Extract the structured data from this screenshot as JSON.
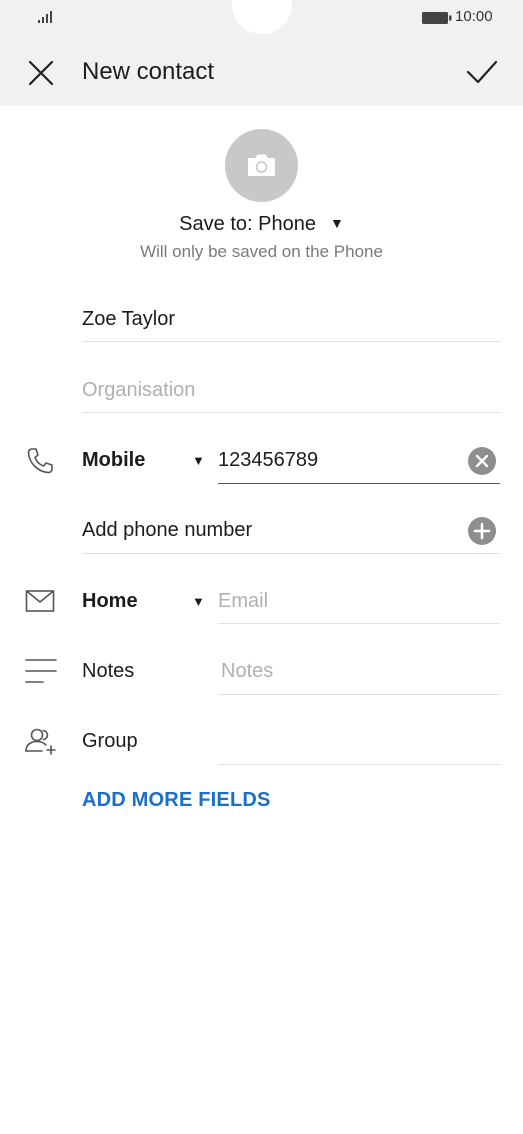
{
  "status": {
    "time": "10:00"
  },
  "header": {
    "title": "New contact"
  },
  "save_to": {
    "label": "Save to: Phone",
    "hint": "Will only be saved on the Phone"
  },
  "fields": {
    "name_value": "Zoe Taylor",
    "organisation_placeholder": "Organisation",
    "phone_type": "Mobile",
    "phone_value": "123456789",
    "add_phone_label": "Add phone number",
    "email_type": "Home",
    "email_placeholder": "Email",
    "notes_label": "Notes",
    "notes_placeholder": "Notes",
    "group_label": "Group"
  },
  "actions": {
    "add_more_fields": "ADD MORE FIELDS"
  },
  "colors": {
    "accent": "#1a6fc9",
    "header_bg": "#f1f1f1",
    "avatar_bg": "#c8c8c8"
  }
}
